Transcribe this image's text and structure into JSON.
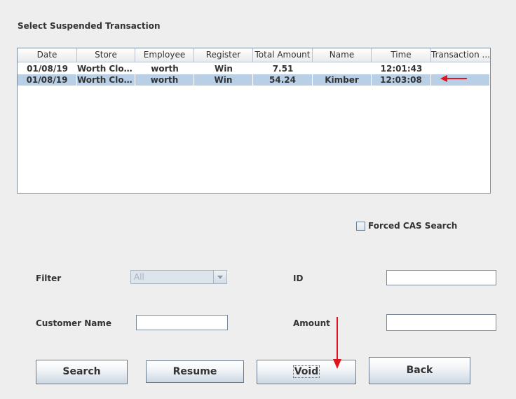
{
  "title": "Select Suspended Transaction",
  "table": {
    "columns": [
      "Date",
      "Store",
      "Employee",
      "Register",
      "Total Amount",
      "Name",
      "Time",
      "Transaction ..."
    ],
    "rows": [
      {
        "date": "01/08/19",
        "store": "Worth Clot...",
        "employee": "worth",
        "register": "Win",
        "total": "7.51",
        "name": "",
        "time": "12:01:43",
        "transaction": ""
      },
      {
        "date": "01/08/19",
        "store": "Worth Clot...",
        "employee": "worth",
        "register": "Win",
        "total": "54.24",
        "name": "Kimber",
        "time": "12:03:08",
        "transaction": ""
      }
    ],
    "selected_row_index": 1
  },
  "forced_cas": {
    "label": "Forced CAS Search",
    "checked": false
  },
  "filter": {
    "label": "Filter",
    "value": "All"
  },
  "id_field": {
    "label": "ID",
    "value": ""
  },
  "customer_name": {
    "label": "Customer Name",
    "value": ""
  },
  "amount": {
    "label": "Amount",
    "value": ""
  },
  "buttons": {
    "search": "Search",
    "resume": "Resume",
    "void": "Void",
    "back": "Back"
  },
  "colors": {
    "annotation_arrow": "#e0141e",
    "selection": "#b8cfe5"
  }
}
